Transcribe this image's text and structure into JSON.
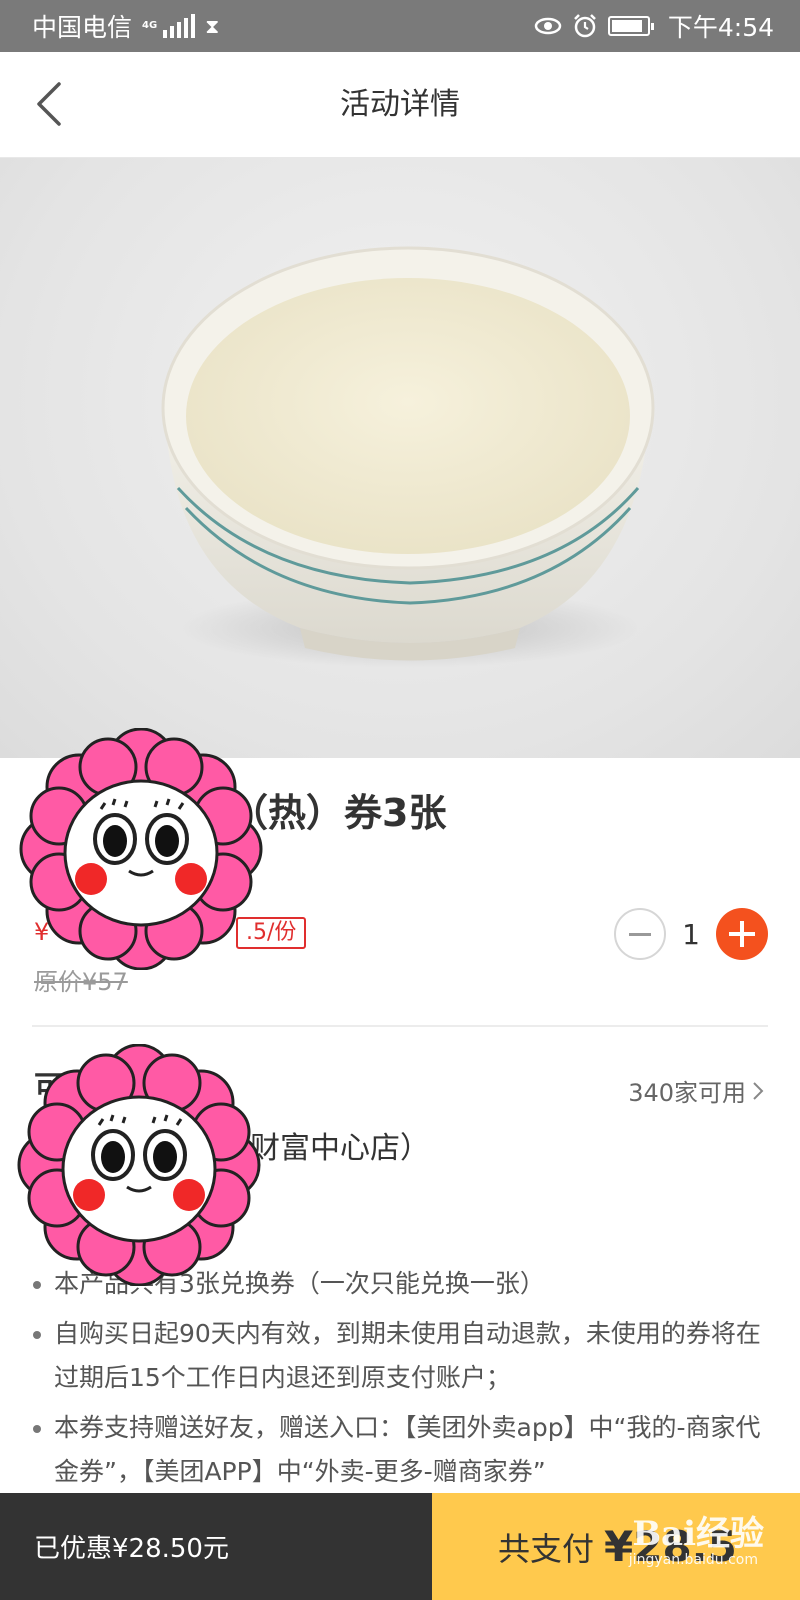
{
  "status_bar": {
    "carrier": "中国电信",
    "network": "4G",
    "time": "下午4:54"
  },
  "nav": {
    "title": "活动详情"
  },
  "product": {
    "title_partial": "（热）券3张",
    "price_partial": ".5/份",
    "price_prefix": "¥",
    "original_price": "原价¥57",
    "quantity": "1"
  },
  "stores": {
    "heading_partial": "可",
    "available_link": "340家可用",
    "store_name_partial": "财富中心店）"
  },
  "rules": [
    "本产品共有3张兑换券（一次只能兑换一张）",
    "自购买日起90天内有效，到期未使用自动退款，未使用的券将在过期后15个工作日内退还到原支付账户；",
    "本券支持赠送好友，赠送入口：【美团外卖app】中“我的-商家代金券”，【美团APP】中“外卖-更多-赠商家券”"
  ],
  "bottom_bar": {
    "discount": "已优惠¥28.50元",
    "pay_label": "共支付",
    "pay_amount": "¥28.5"
  },
  "watermark": {
    "text": "Bai经验",
    "sub": "jingyan.baidu.com"
  },
  "icons": [
    "back-arrow-icon",
    "signal-icon",
    "hourglass-icon",
    "eye-icon",
    "alarm-icon",
    "battery-icon",
    "minus-icon",
    "plus-icon",
    "chevron-right-icon"
  ],
  "colors": {
    "accent_orange": "#f4511e",
    "price_red": "#e02e2e",
    "pay_yellow": "#ffc94d",
    "bottom_dark": "#333333",
    "status_gray": "#7a7a7a",
    "sticker_pink": "#ff5aa5"
  }
}
